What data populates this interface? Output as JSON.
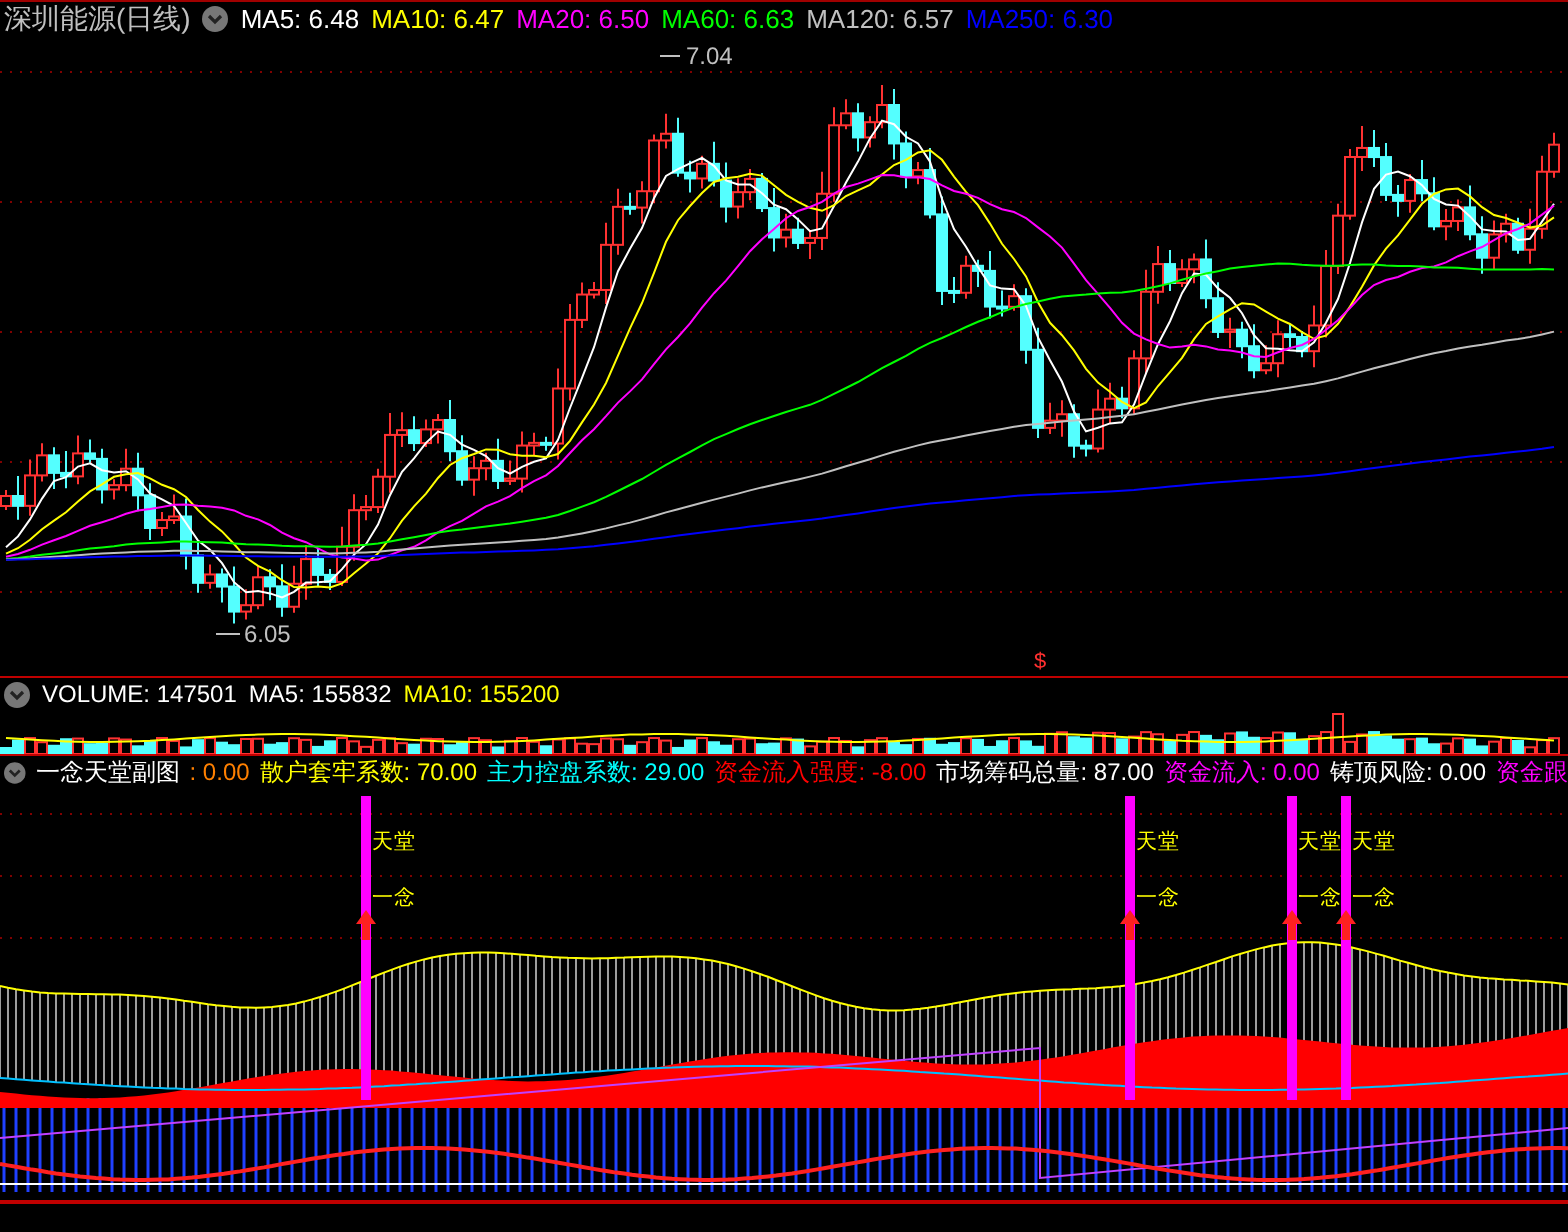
{
  "price_panel": {
    "title": "深圳能源(日线)",
    "moving_averages": [
      {
        "label": "MA5: 6.48",
        "color": "#ffffff"
      },
      {
        "label": "MA10: 6.47",
        "color": "#ffff00"
      },
      {
        "label": "MA20: 6.50",
        "color": "#ff00ff"
      },
      {
        "label": "MA60: 6.63",
        "color": "#00ff00"
      },
      {
        "label": "MA120: 6.57",
        "color": "#c0c0c0"
      },
      {
        "label": "MA250: 6.30",
        "color": "#0000ff"
      }
    ],
    "high_label": "7.04",
    "low_label": "6.05",
    "marker": "$"
  },
  "volume_panel": {
    "items": [
      {
        "label": "VOLUME: 147501",
        "color": "#ffffff"
      },
      {
        "label": "MA5: 155832",
        "color": "#ffffff"
      },
      {
        "label": "MA10: 155200",
        "color": "#ffff00"
      }
    ]
  },
  "indicator_panel": {
    "items": [
      {
        "label": "一念天堂副图",
        "color": "#ffffff"
      },
      {
        "label": ": 0.00",
        "color": "#ff8000"
      },
      {
        "label": "散户套牢系数: 70.00",
        "color": "#ffff00"
      },
      {
        "label": "主力控盘系数: 29.00",
        "color": "#00ffff"
      },
      {
        "label": "资金流入强度: -8.00",
        "color": "#ff0000"
      },
      {
        "label": "市场筹码总量: 87.00",
        "color": "#ffffff"
      },
      {
        "label": "资金流入: 0.00",
        "color": "#ff00ff"
      },
      {
        "label": "铸顶风险: 0.00",
        "color": "#ffffff"
      },
      {
        "label": "资金跟",
        "color": "#ff00ff"
      }
    ],
    "signals": [
      {
        "top": "天堂",
        "bottom": "一念"
      },
      {
        "top": "天堂",
        "bottom": "一念"
      },
      {
        "top": "天堂",
        "bottom": "一念"
      },
      {
        "top": "天堂",
        "bottom": "一念"
      }
    ]
  }
}
